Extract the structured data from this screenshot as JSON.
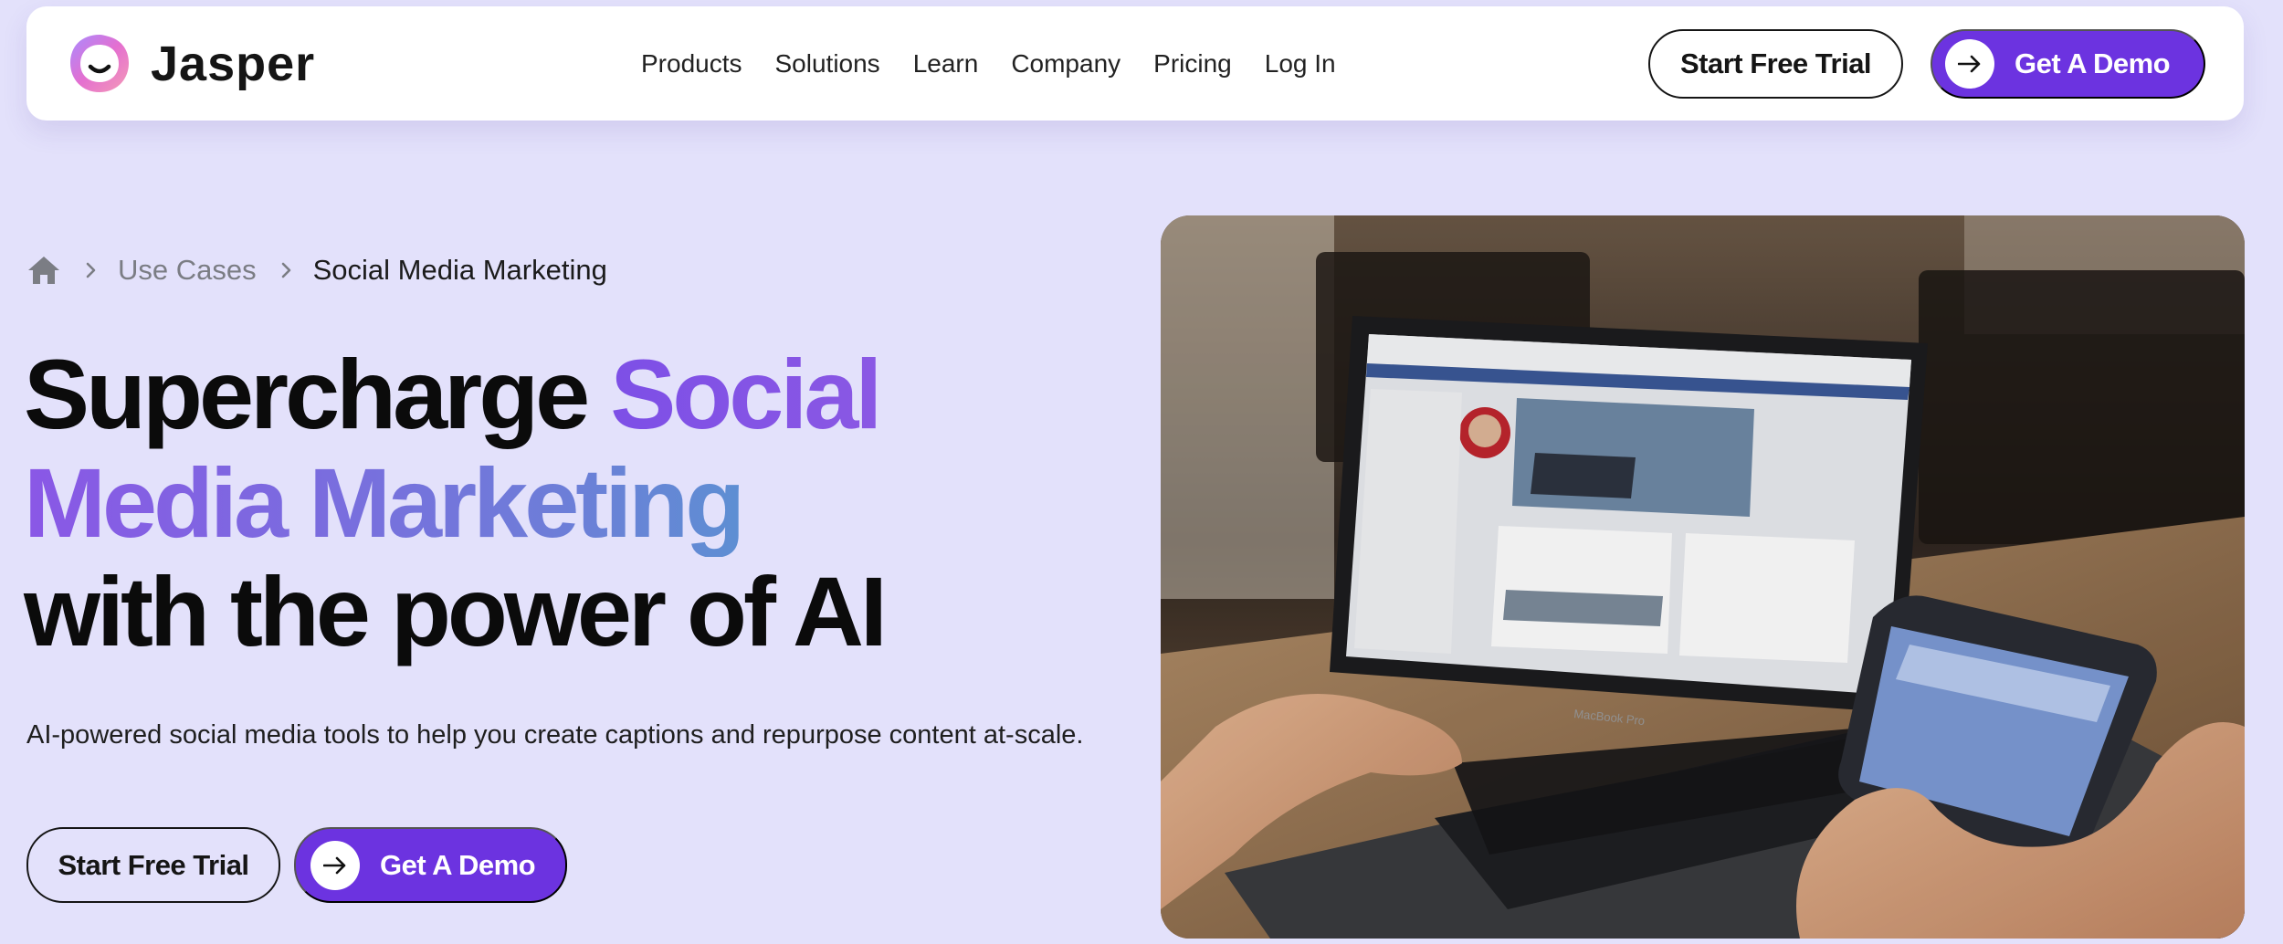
{
  "brand": {
    "name": "Jasper"
  },
  "nav": {
    "links": [
      "Products",
      "Solutions",
      "Learn",
      "Company",
      "Pricing",
      "Log In"
    ],
    "trial_label": "Start Free Trial",
    "demo_label": "Get A Demo"
  },
  "breadcrumb": {
    "items": [
      "Use Cases",
      "Social Media Marketing"
    ]
  },
  "hero": {
    "headline_line1_plain": "Supercharge ",
    "headline_line1_accent": "Social",
    "headline_line2_accent": "Media Marketing",
    "headline_line3": "with the power of AI",
    "subtitle": "AI-powered social media tools to help you create captions and repurpose content at-scale.",
    "trial_label": "Start Free Trial",
    "demo_label": "Get A Demo",
    "image_laptop_brand": "MacBook Pro"
  },
  "colors": {
    "background": "#e3e1fb",
    "accent_purple": "#6c33e0",
    "gradient_start": "#8a57e6",
    "gradient_end": "#3fb0c8"
  },
  "icons": [
    "jasper-logo-icon",
    "home-icon",
    "chevron-right-icon",
    "arrow-right-icon"
  ]
}
